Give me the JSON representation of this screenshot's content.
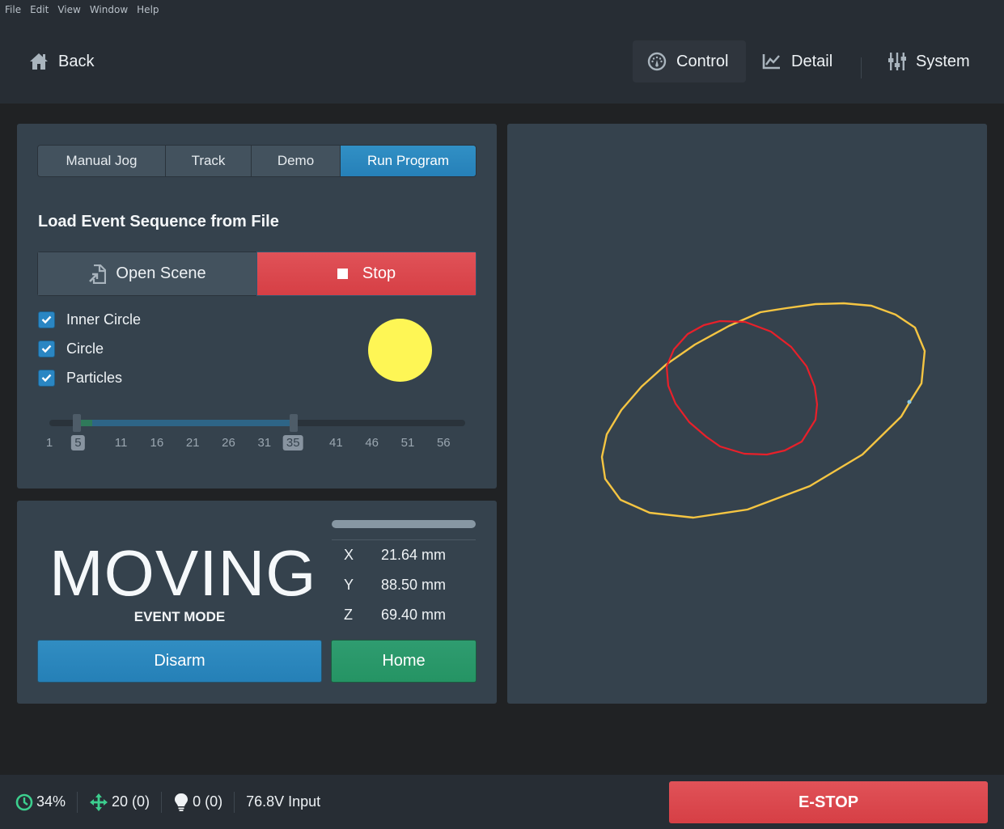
{
  "menubar": {
    "items": [
      "File",
      "Edit",
      "View",
      "Window",
      "Help"
    ]
  },
  "header": {
    "back_label": "Back",
    "back_icon": "home-icon",
    "nav": [
      {
        "label": "Control",
        "icon": "dashboard-gauge-icon",
        "active": true
      },
      {
        "label": "Detail",
        "icon": "line-chart-icon",
        "active": false
      },
      {
        "label": "System",
        "icon": "sliders-icon",
        "active": false
      }
    ]
  },
  "program_panel": {
    "tabs": [
      {
        "label": "Manual Jog",
        "active": false
      },
      {
        "label": "Track",
        "active": false
      },
      {
        "label": "Demo",
        "active": false
      },
      {
        "label": "Run Program",
        "active": true
      }
    ],
    "section_title": "Load Event Sequence from File",
    "open_scene_label": "Open Scene",
    "open_scene_icon": "file-import-icon",
    "stop_label": "Stop",
    "stop_icon": "stop-square-icon",
    "layers": [
      {
        "label": "Inner Circle",
        "checked": true
      },
      {
        "label": "Circle",
        "checked": true
      },
      {
        "label": "Particles",
        "checked": true
      }
    ],
    "indicator_color": "#fef655",
    "range_slider": {
      "min": 1,
      "max": 58,
      "low": 5,
      "high": 35,
      "played_to": 7,
      "ticks": [
        "1",
        "5",
        "11",
        "16",
        "21",
        "26",
        "31",
        "35",
        "41",
        "46",
        "51",
        "56"
      ],
      "selected_ticks": [
        "5",
        "35"
      ]
    }
  },
  "status_panel": {
    "state": "MOVING",
    "mode": "EVENT MODE",
    "progress_fraction": 1.0,
    "coords": [
      {
        "axis": "X",
        "value": "21.64 mm"
      },
      {
        "axis": "Y",
        "value": "88.50 mm"
      },
      {
        "axis": "Z",
        "value": "69.40 mm"
      }
    ],
    "disarm_label": "Disarm",
    "home_label": "Home"
  },
  "viewer": {
    "paths": [
      {
        "name": "circle",
        "color": "#f5c542"
      },
      {
        "name": "inner-circle",
        "color": "#e8202a"
      }
    ],
    "cursor_color": "#8ccbe6"
  },
  "footer": {
    "cpu": "34%",
    "cpu_icon": "clock-icon",
    "moves": "20 (0)",
    "moves_icon": "move-arrows-icon",
    "lights": "0 (0)",
    "lights_icon": "lightbulb-icon",
    "voltage": "76.8V Input",
    "estop_label": "E-STOP"
  },
  "colors": {
    "accent_blue": "#2a86c3",
    "danger_red": "#d63f45",
    "success_green": "#259464",
    "status_green": "#3ccf8e"
  }
}
